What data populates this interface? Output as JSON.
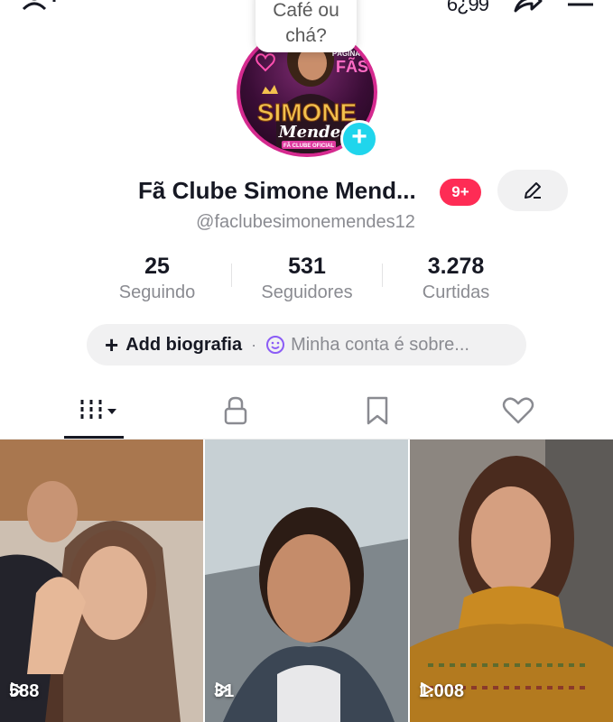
{
  "header": {
    "bubble_line1": "Café ou",
    "bubble_line2": "chá?",
    "coins_text": "6¿99"
  },
  "profile": {
    "avatar_text_line1": "SIMONE",
    "avatar_text_line2": "Mendes",
    "avatar_sub": "FÃ CLUBE OFICIAL",
    "avatar_corner_line1": "PÁGINA DE",
    "avatar_corner_line2": "FÃS",
    "name": "Fã Clube Simone Mend...",
    "notification_badge": "9+",
    "handle": "@faclubesimonemendes12"
  },
  "stats": [
    {
      "value": "25",
      "label": "Seguindo"
    },
    {
      "value": "531",
      "label": "Seguidores"
    },
    {
      "value": "3.278",
      "label": "Curtidas"
    }
  ],
  "bio": {
    "plus": "+",
    "add_label": "Add biografia",
    "separator": "·",
    "hint": "Minha conta é sobre..."
  },
  "tabs": [
    {
      "name": "videos",
      "icon": "grid-icon",
      "active": true
    },
    {
      "name": "private",
      "icon": "lock-icon"
    },
    {
      "name": "favorites",
      "icon": "bookmark-icon"
    },
    {
      "name": "liked",
      "icon": "heart-icon"
    }
  ],
  "videos": [
    {
      "views": "588"
    },
    {
      "views": "31"
    },
    {
      "views": "1.008"
    }
  ],
  "colors": {
    "accent_red": "#fe2c55",
    "accent_cyan": "#20d5ec",
    "text_primary": "#161823",
    "text_secondary": "#8a8b91",
    "bio_smile": "#8b5cf6"
  }
}
